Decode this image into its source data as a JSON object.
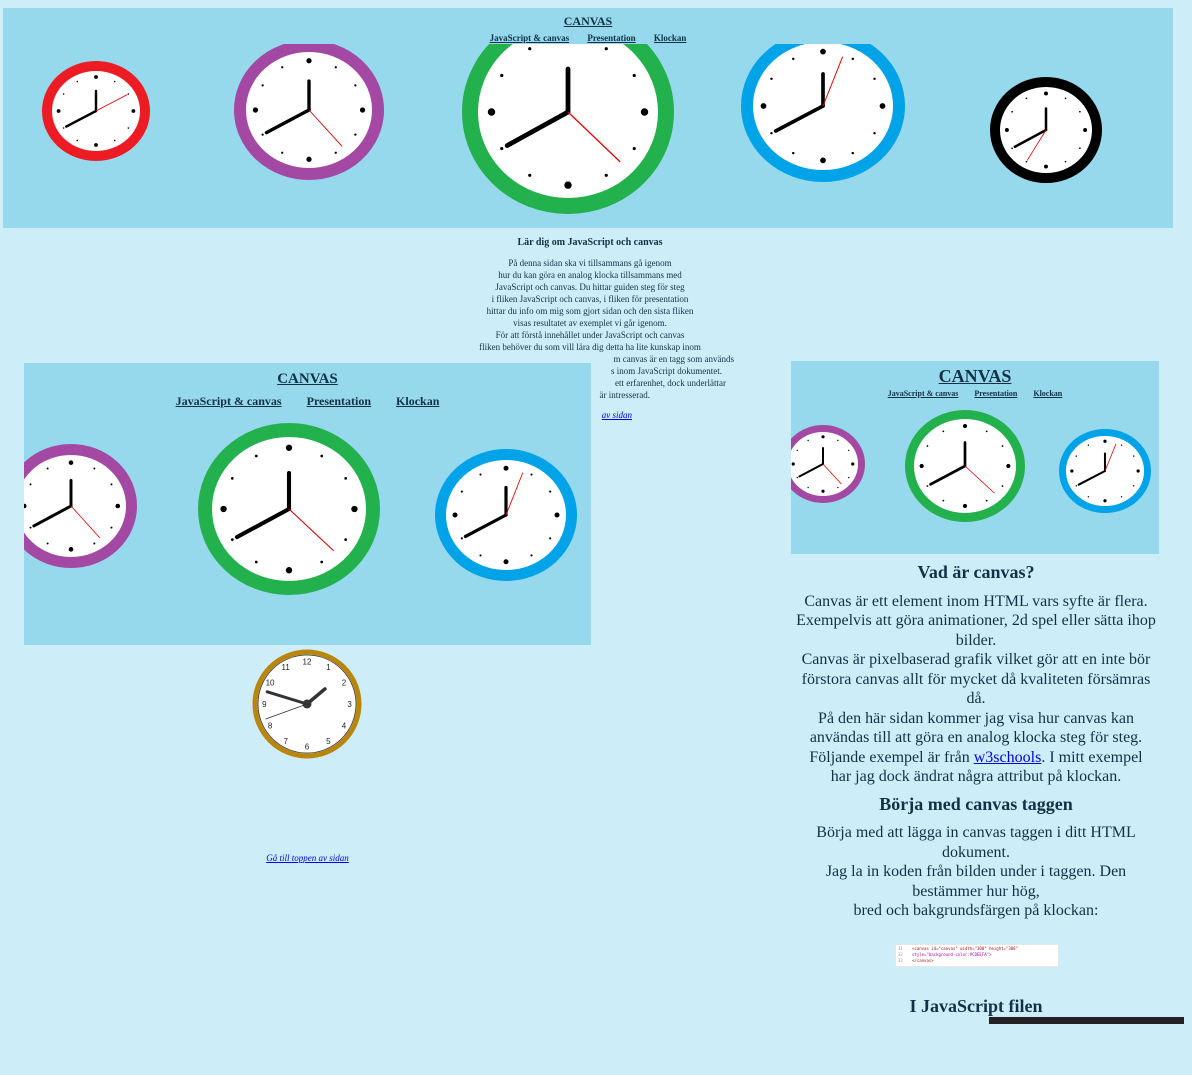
{
  "site": {
    "title": "CANVAS",
    "nav": [
      "JavaScript & canvas",
      "Presentation",
      "Klockan"
    ]
  },
  "main_view": {
    "intro_heading": "Lär dig om JavaScript och canvas",
    "intro_lines": [
      "På denna sidan ska vi tillsammans gå igenom",
      "hur du kan göra en analog klocka tillsammans med",
      "JavaScript och canvas. Du hittar guiden steg för steg",
      "i fliken JavaScript och canvas, i fliken för presentation",
      "hittar du info om mig som gjort sidan och den sista fliken",
      "visas resultatet av exemplet vi går igenom.",
      "För att förstå innehållet under JavaScript och canvas",
      "fliken behöver du som vill lära dig detta ha lite kunskap inom",
      "m canvas är en tagg som används",
      "s inom JavaScript dokumentet.",
      "ett erfarenhet, dock underlättar",
      "är intresserad."
    ],
    "partial_link": "av sidan"
  },
  "tablet_view": {
    "back_to_top": "Gå till toppen av sidan",
    "analog_clock_numbers": [
      "12",
      "1",
      "2",
      "3",
      "4",
      "5",
      "6",
      "7",
      "8",
      "9",
      "10",
      "11"
    ]
  },
  "phone_view": {
    "section1_heading": "Vad är canvas?",
    "section1_paragraphs": [
      "Canvas är ett element inom HTML vars syfte är flera. Exempelvis att göra animationer, 2d spel eller sätta ihop bilder.",
      "Canvas är pixelbaserad grafik vilket gör att en inte bör förstora canvas allt för mycket då kvaliteten försämras då.",
      "På den här sidan kommer jag visa hur canvas kan användas till att göra en analog klocka steg för steg."
    ],
    "example_prefix": "Följande exempel är från ",
    "example_link": "w3schools",
    "example_suffix": ". I mitt exempel har jag dock ändrat några attribut på klockan.",
    "section2_heading": "Börja med canvas taggen",
    "section2_lines": [
      "Börja med att lägga in canvas taggen i ditt HTML dokument.",
      "Jag la in koden från bilden under i taggen. Den bestämmer hur hög,",
      "bred och bakgrundsfärgen på klockan:"
    ],
    "code_lines": [
      {
        "ln": "31",
        "text": "<canvas id=\"canvas\" width=\"300\" height=\"300\""
      },
      {
        "ln": "32",
        "text": "style=\"background-color:#CDEEFA\">"
      },
      {
        "ln": "33",
        "text": "</canvas>"
      }
    ],
    "section3_heading": "I JavaScript filen"
  },
  "colors": {
    "page_bg": "#cdeef9",
    "header_bg": "#96d8ec",
    "text": "#123146",
    "clock_red": "#ed1c24",
    "clock_purple": "#a349a4",
    "clock_green": "#22b14c",
    "clock_blue": "#00a2e8",
    "clock_black": "#000000",
    "clock_gold": "#b8860b"
  }
}
